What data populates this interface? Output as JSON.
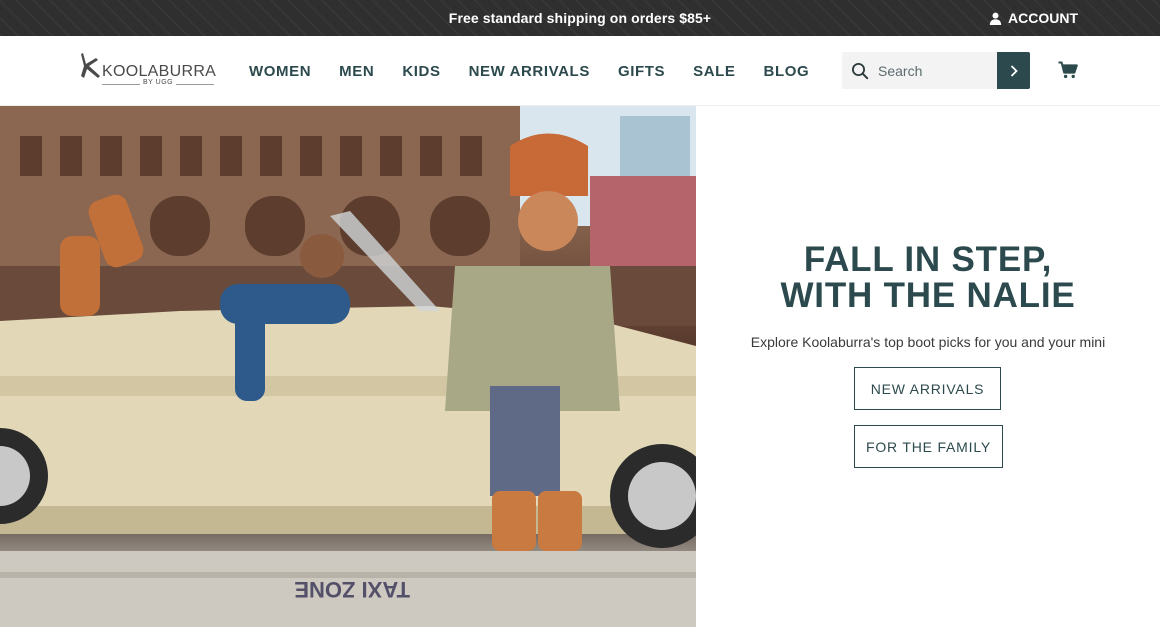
{
  "promo": {
    "text": "Free standard shipping on orders $85+"
  },
  "account": {
    "label": "ACCOUNT",
    "icon": "user-icon"
  },
  "brand": {
    "name": "KOOLABURRA",
    "sub": "BY UGG"
  },
  "nav": {
    "items": [
      {
        "label": "WOMEN"
      },
      {
        "label": "MEN"
      },
      {
        "label": "KIDS"
      },
      {
        "label": "NEW ARRIVALS"
      },
      {
        "label": "GIFTS"
      },
      {
        "label": "SALE"
      },
      {
        "label": "BLOG"
      }
    ]
  },
  "search": {
    "placeholder": "Search",
    "value": ""
  },
  "hero": {
    "headline_line1": "FALL IN STEP,",
    "headline_line2": "WITH THE NALIE",
    "subline": "Explore Koolaburra's top boot picks for you and your mini",
    "cta_primary": "NEW ARRIVALS",
    "cta_secondary": "FOR THE FAMILY",
    "image_text": "TAXI ZONE"
  },
  "colors": {
    "brand_teal": "#2c4a4d",
    "promo_bar": "#2f2f2f",
    "search_bg": "#f3f3f3"
  }
}
